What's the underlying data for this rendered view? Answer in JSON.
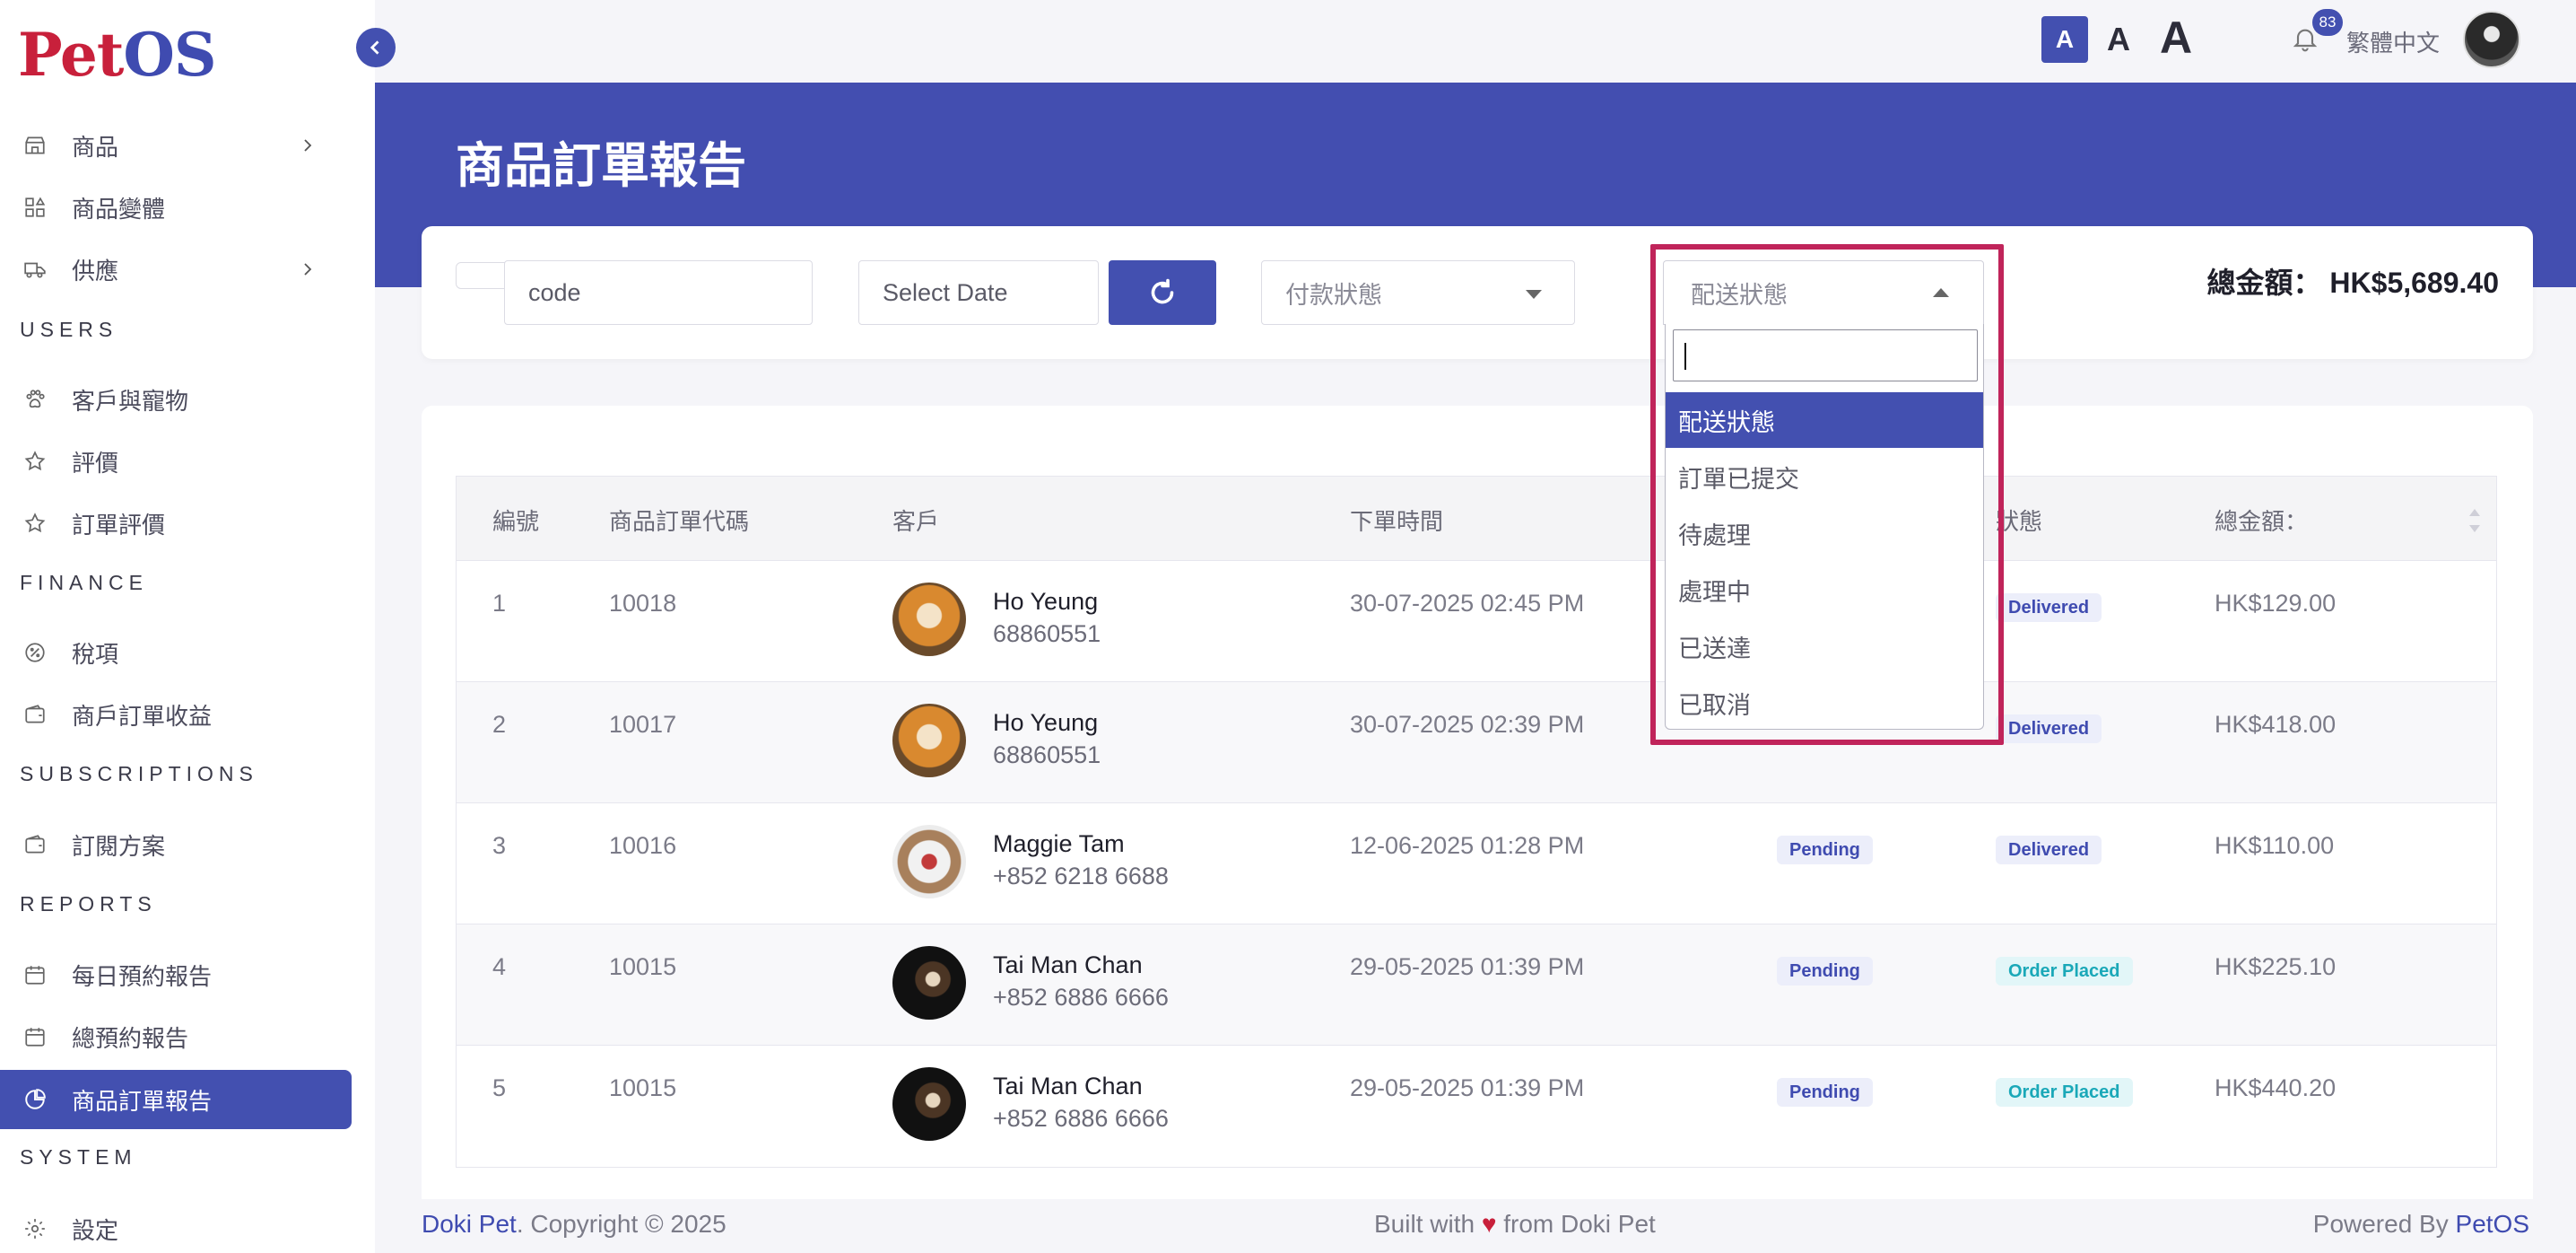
{
  "app": {
    "logo_part1": "Pet",
    "logo_part2": "OS",
    "page_title": "商品訂單報告",
    "language": "繁體中文",
    "notification_count": "83",
    "font_size_labels": [
      "A",
      "A",
      "A"
    ],
    "accent_color": "#4350b0"
  },
  "sidebar": {
    "items": [
      {
        "label": "商品",
        "icon": "store-icon",
        "has_children": true
      },
      {
        "label": "商品變體",
        "icon": "variants-icon",
        "has_children": false
      },
      {
        "label": "供應",
        "icon": "truck-icon",
        "has_children": true
      }
    ],
    "sections": [
      {
        "title": "USERS",
        "items": [
          {
            "label": "客戶與寵物",
            "icon": "paw-icon"
          },
          {
            "label": "評價",
            "icon": "star-icon"
          },
          {
            "label": "訂單評價",
            "icon": "star-icon"
          }
        ]
      },
      {
        "title": "FINANCE",
        "items": [
          {
            "label": "稅項",
            "icon": "tax-icon"
          },
          {
            "label": "商戶訂單收益",
            "icon": "wallet-icon"
          }
        ]
      },
      {
        "title": "SUBSCRIPTIONS",
        "items": [
          {
            "label": "訂閱方案",
            "icon": "wallet-icon"
          }
        ]
      },
      {
        "title": "REPORTS",
        "items": [
          {
            "label": "每日預約報告",
            "icon": "calendar-icon"
          },
          {
            "label": "總預約報告",
            "icon": "calendar-icon"
          },
          {
            "label": "商品訂單報告",
            "icon": "chart-pie-icon",
            "active": true
          }
        ]
      },
      {
        "title": "SYSTEM",
        "items": [
          {
            "label": "設定",
            "icon": "gear-icon"
          }
        ]
      }
    ]
  },
  "filters": {
    "code_value": "code",
    "date_placeholder": "Select Date",
    "payment_status_placeholder": "付款狀態",
    "delivery_status_placeholder": "配送狀態",
    "total_label": "總金額：",
    "total_value": "HK$5,689.40"
  },
  "dropdown": {
    "search_value": "",
    "options": [
      "配送狀態",
      "訂單已提交",
      "待處理",
      "處理中",
      "已送達",
      "已取消"
    ],
    "selected_index": 0
  },
  "table": {
    "headers": [
      "編號",
      "商品訂單代碼",
      "客戶",
      "下單時間",
      "",
      "狀態",
      "總金額："
    ],
    "rows": [
      {
        "no": "1",
        "code": "10018",
        "name": "Ho Yeung",
        "phone": "68860551",
        "time": "30-07-2025 02:45 PM",
        "payment": "",
        "status": "Delivered",
        "total": "HK$129.00",
        "avatar": "shiba"
      },
      {
        "no": "2",
        "code": "10017",
        "name": "Ho Yeung",
        "phone": "68860551",
        "time": "30-07-2025 02:39 PM",
        "payment": "",
        "status": "Delivered",
        "total": "HK$418.00",
        "avatar": "shiba"
      },
      {
        "no": "3",
        "code": "10016",
        "name": "Maggie Tam",
        "phone": "+852 6218 6688",
        "time": "12-06-2025 01:28 PM",
        "payment": "Pending",
        "status": "Delivered",
        "total": "HK$110.00",
        "avatar": "maggie"
      },
      {
        "no": "4",
        "code": "10015",
        "name": "Tai Man Chan",
        "phone": "+852 6886 6666",
        "time": "29-05-2025 01:39 PM",
        "payment": "Pending",
        "status": "Order Placed",
        "total": "HK$225.10",
        "avatar": "tai"
      },
      {
        "no": "5",
        "code": "10015",
        "name": "Tai Man Chan",
        "phone": "+852 6886 6666",
        "time": "29-05-2025 01:39 PM",
        "payment": "Pending",
        "status": "Order Placed",
        "total": "HK$440.20",
        "avatar": "tai"
      }
    ]
  },
  "footer": {
    "left_brand": "Doki Pet",
    "left_text": ". Copyright © 2025",
    "center_before": "Built with ",
    "center_heart": "♥",
    "center_after": " from Doki Pet",
    "right_text": "Powered By ",
    "right_brand": "PetOS"
  }
}
